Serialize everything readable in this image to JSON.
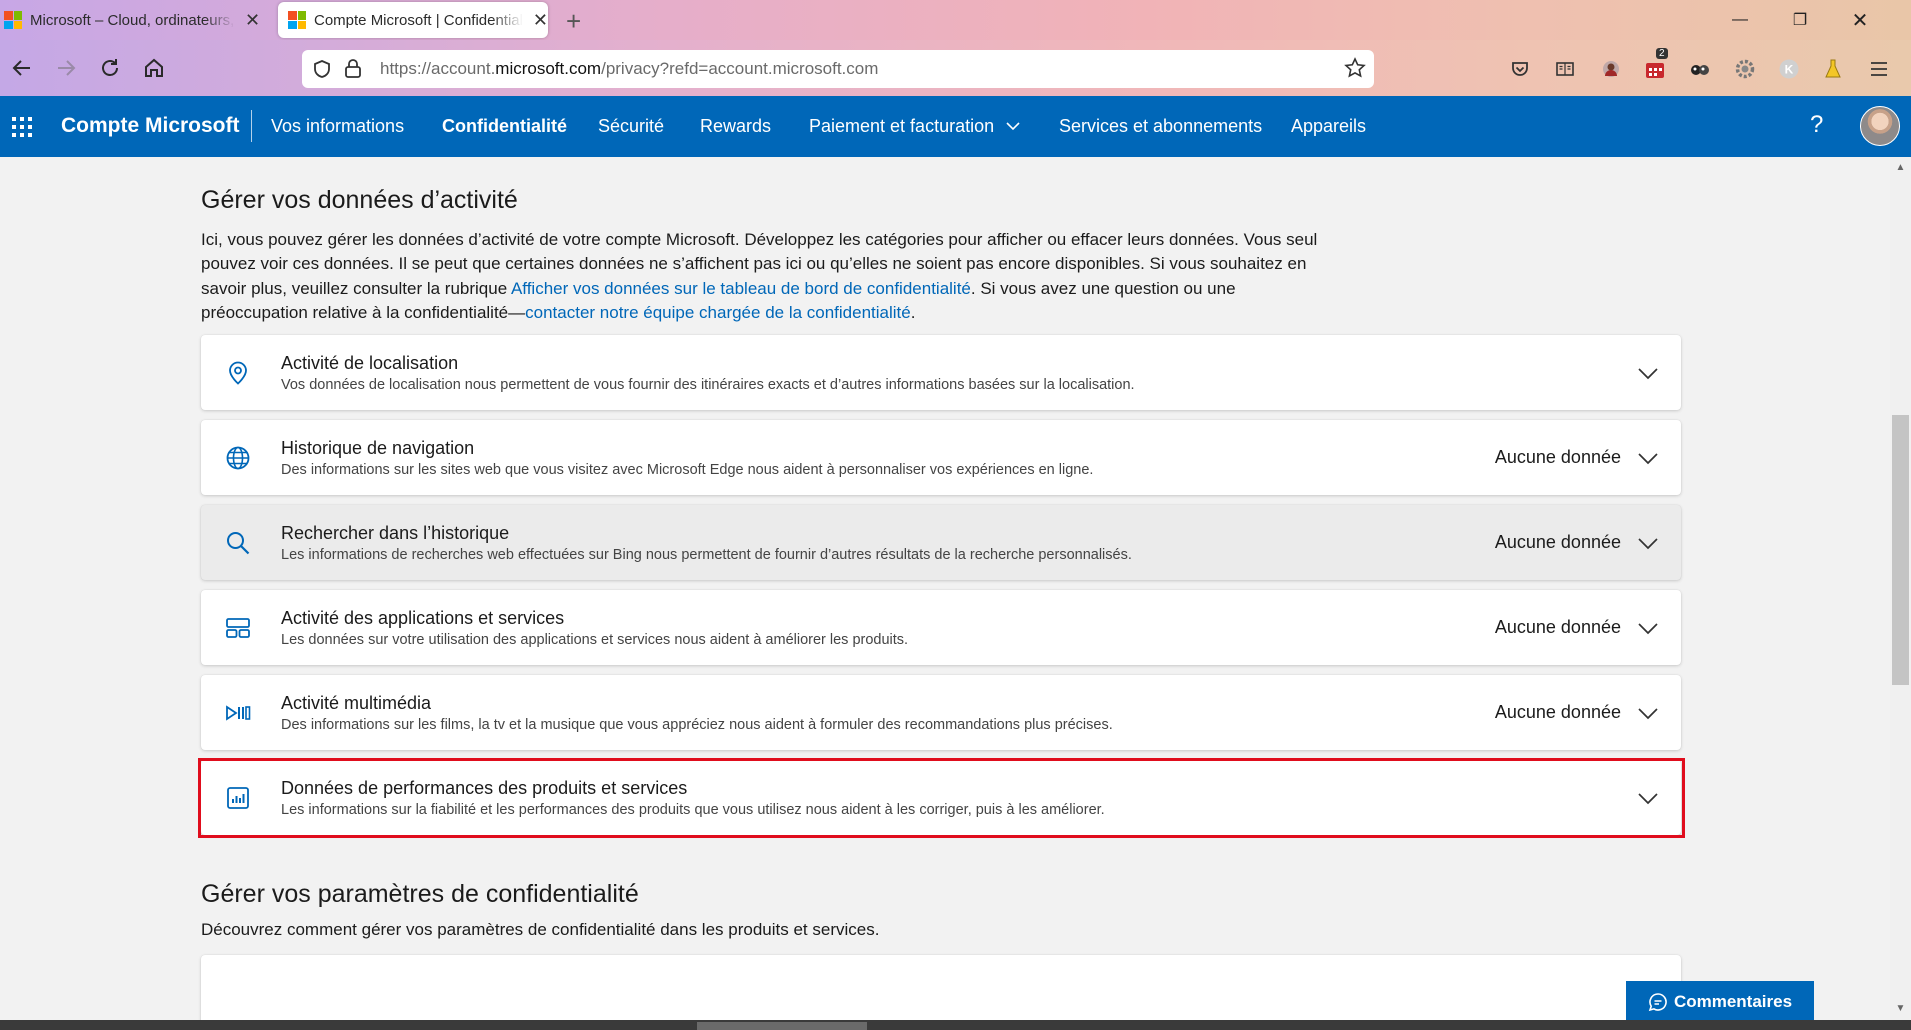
{
  "browser": {
    "tabs": [
      {
        "title": "Microsoft – Cloud, ordinateurs, applications et jeux"
      },
      {
        "title": "Compte Microsoft | Confidentialité"
      }
    ],
    "url_prefix": "https://account.",
    "url_domain": "microsoft.com",
    "url_suffix": "/privacy?refd=account.microsoft.com",
    "extension_badge": "2"
  },
  "header": {
    "brand": "Compte Microsoft",
    "nav": [
      {
        "label": "Vos informations"
      },
      {
        "label": "Confidentialité",
        "active": true
      },
      {
        "label": "Sécurité"
      },
      {
        "label": "Rewards"
      },
      {
        "label": "Paiement et facturation"
      },
      {
        "label": "Services et abonnements"
      },
      {
        "label": "Appareils"
      }
    ],
    "help": "?"
  },
  "activity": {
    "title": "Gérer vos données d’activité",
    "intro_1": "Ici, vous pouvez gérer les données d’activité de votre compte Microsoft. Développez les catégories pour afficher ou effacer leurs données. Vous seul pouvez voir ces données. Il se peut que certaines données ne s’affichent pas ici ou qu’elles ne soient pas encore disponibles. Si vous souhaitez en savoir plus, veuillez consulter la rubrique ",
    "intro_link_1": "Afficher vos données sur le tableau de bord de confidentialité",
    "intro_2": ". Si vous avez une question ou une préoccupation relative à la confidentialité—",
    "intro_link_2": "contacter notre équipe chargée de la confidentialité",
    "intro_3": ".",
    "items": [
      {
        "title": "Activité de localisation",
        "desc": "Vos données de localisation nous permettent de vous fournir des itinéraires exacts et d’autres informations basées sur la localisation.",
        "status": "",
        "icon": "location-pin-icon"
      },
      {
        "title": "Historique de navigation",
        "desc": "Des informations sur les sites web que vous visitez avec Microsoft Edge nous aident à personnaliser vos expériences en ligne.",
        "status": "Aucune donnée",
        "icon": "globe-icon"
      },
      {
        "title": "Rechercher dans l’historique",
        "desc": "Les informations de recherches web effectuées sur Bing nous permettent de fournir d’autres résultats de la recherche personnalisés.",
        "status": "Aucune donnée",
        "icon": "search-icon"
      },
      {
        "title": "Activité des applications et services",
        "desc": "Les données sur votre utilisation des applications et services nous aident à améliorer les produits.",
        "status": "Aucune donnée",
        "icon": "apps-icon"
      },
      {
        "title": "Activité multimédia",
        "desc": "Des informations sur les films, la tv et la musique que vous appréciez nous aident à formuler des recommandations plus précises.",
        "status": "Aucune donnée",
        "icon": "media-icon"
      },
      {
        "title": "Données de performances des produits et services",
        "desc": "Les informations sur la fiabilité et les performances des produits que vous utilisez nous aident à les corriger, puis à les améliorer.",
        "status": "",
        "icon": "chart-icon"
      }
    ]
  },
  "privacy_settings": {
    "title": "Gérer vos paramètres de confidentialité",
    "desc": "Découvrez comment gérer vos paramètres de confidentialité dans les produits et services."
  },
  "feedback": {
    "label": "Commentaires"
  },
  "colors": {
    "brand_blue": "#0067b8",
    "highlight_red": "#e00d1d"
  }
}
